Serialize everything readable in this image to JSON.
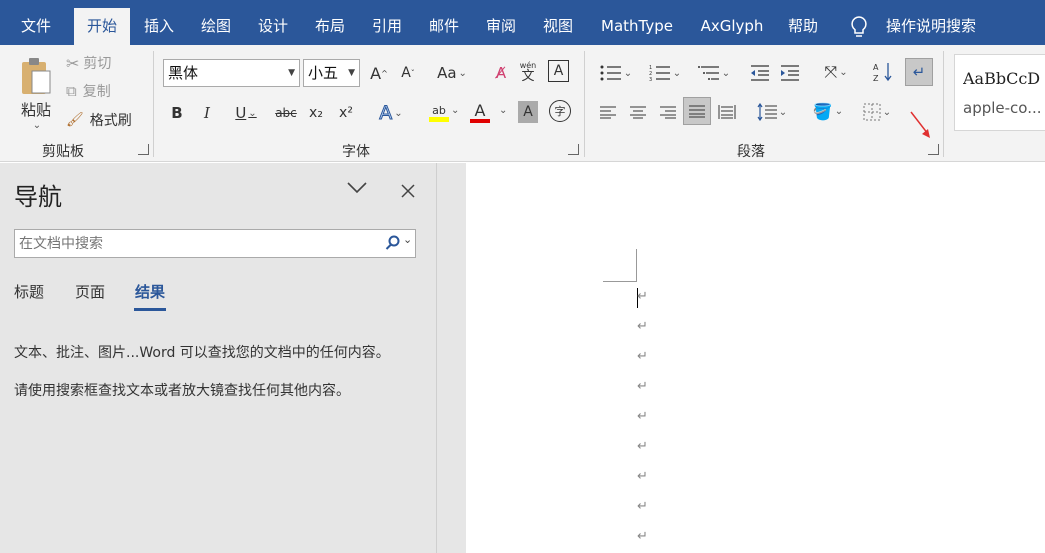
{
  "tabs": [
    "文件",
    "开始",
    "插入",
    "绘图",
    "设计",
    "布局",
    "引用",
    "邮件",
    "审阅",
    "视图",
    "MathType",
    "AxGlyph",
    "帮助"
  ],
  "tell_me": "操作说明搜索",
  "clipboard": {
    "paste": "粘贴",
    "cut": "剪切",
    "copy": "复制",
    "format_painter": "格式刷",
    "group": "剪贴板"
  },
  "font": {
    "name": "黑体",
    "size": "小五",
    "group": "字体",
    "grow": "A",
    "shrink": "A",
    "case": "Aa",
    "bold": "B",
    "italic": "I",
    "underline": "U",
    "strike": "abc",
    "sub": "x₂",
    "sup": "x²",
    "pinyin_top": "wén",
    "pinyin_bottom": "文",
    "char_border": "A",
    "text_effect": "A",
    "highlight": "ab",
    "font_color": "A",
    "shade": "A",
    "enclose": "字"
  },
  "paragraph": {
    "group": "段落"
  },
  "styles": {
    "sample": "AaBbCcD",
    "name": "apple-co..."
  },
  "nav": {
    "title": "导航",
    "search_placeholder": "在文档中搜索",
    "tabs": [
      "标题",
      "页面",
      "结果"
    ],
    "msg1": "文本、批注、图片...Word 可以查找您的文档中的任何内容。",
    "msg2": "请使用搜索框查找文本或者放大镜查找任何其他内容。"
  },
  "doc": {
    "mark": "↵"
  },
  "colors": {
    "accent": "#2b579a",
    "highlight": "#ffff00",
    "font_color": "#e00000",
    "arrow": "#e03030"
  }
}
